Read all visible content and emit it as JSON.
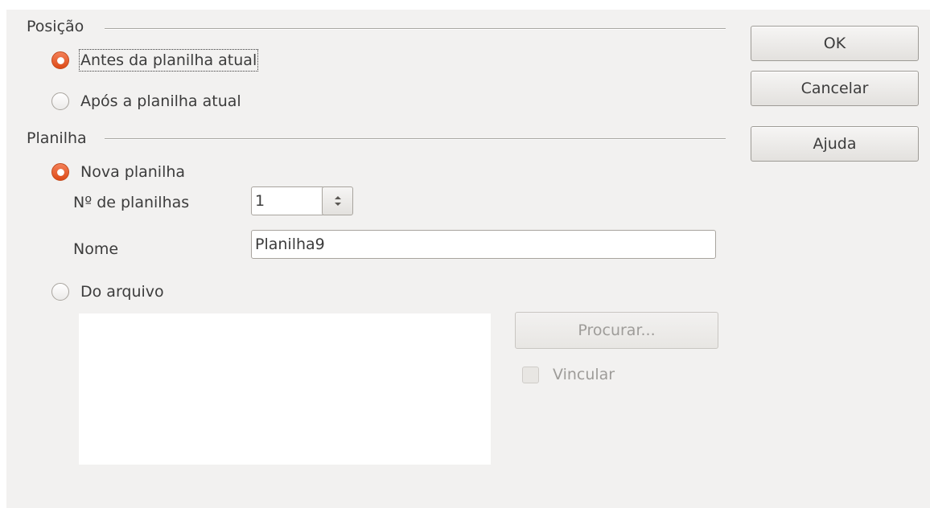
{
  "position": {
    "title": "Posição",
    "before": {
      "label": "Antes da planilha atual",
      "checked": true
    },
    "after": {
      "label": "Após a planilha atual",
      "checked": false
    }
  },
  "sheet": {
    "title": "Planilha",
    "new_sheet": {
      "label": "Nova planilha",
      "checked": true
    },
    "count_label": "Nº de planilhas",
    "count_value": "1",
    "name_label": "Nome",
    "name_value": "Planilha9",
    "from_file": {
      "label": "Do arquivo",
      "checked": false
    },
    "browse_label": "Procurar...",
    "link_label": "Vincular"
  },
  "buttons": {
    "ok": "OK",
    "cancel": "Cancelar",
    "help": "Ajuda"
  },
  "colors": {
    "dialog_bg": "#f2f1f0",
    "radio_checked": "#e9592a"
  },
  "icons": {
    "spin": "up-down-arrows-icon"
  }
}
